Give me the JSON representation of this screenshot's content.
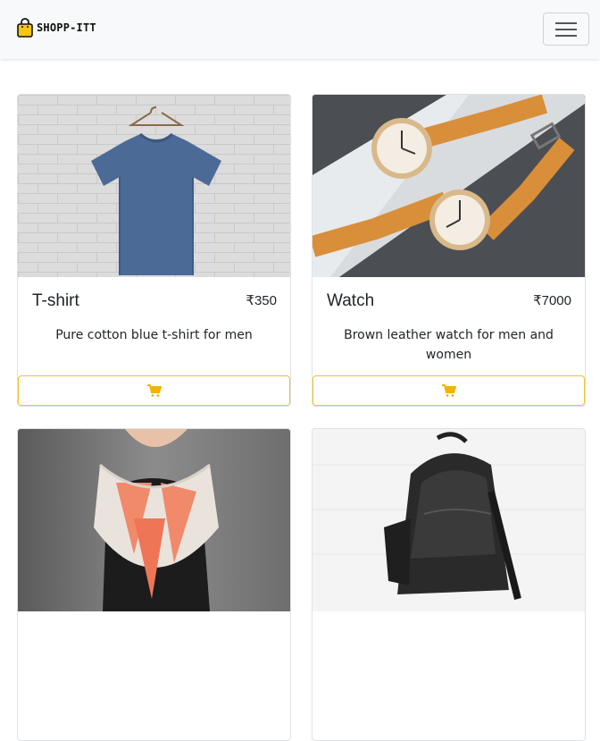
{
  "navbar": {
    "brand": "SHOPP-ITT",
    "brand_icon": "shopping-bag-icon",
    "toggle_icon": "hamburger-menu-icon"
  },
  "colors": {
    "accent": "#ffc107",
    "cart_icon": "#f0b400",
    "navbar_bg": "#f8f9fa"
  },
  "products": [
    {
      "title": "T-shirt",
      "price": "₹350",
      "description": "Pure cotton blue t-shirt for men",
      "image": "blue-tshirt-image",
      "cart_icon": "cart-icon"
    },
    {
      "title": "Watch",
      "price": "₹7000",
      "description": "Brown leather watch for men and women",
      "image": "leather-watch-image",
      "cart_icon": "cart-icon"
    },
    {
      "image": "scarf-image"
    },
    {
      "image": "leather-backpack-image"
    }
  ]
}
